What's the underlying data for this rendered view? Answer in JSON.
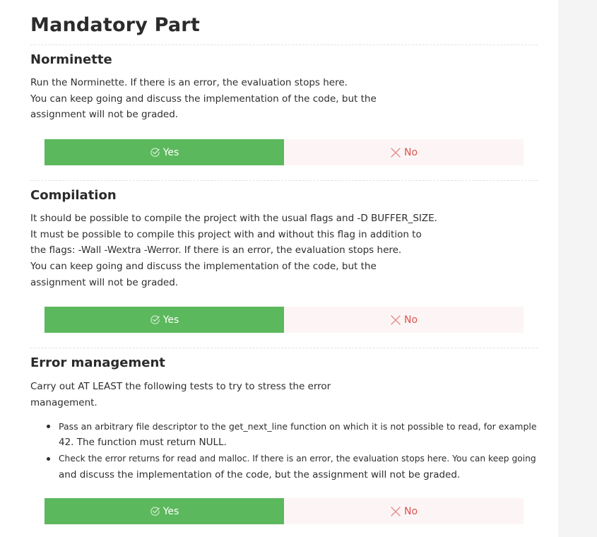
{
  "page": {
    "title": "Mandatory Part"
  },
  "sections": [
    {
      "title": "Norminette",
      "lines": [
        "Run the Norminette. If there is an error, the evaluation stops here.",
        "You can keep going and discuss the implementation of the code, but the",
        "assignment will not be graded."
      ],
      "yes_label": "Yes",
      "no_label": "No"
    },
    {
      "title": "Compilation",
      "lines": [
        "It should be possible to compile the project with the usual flags and -D BUFFER_SIZE.",
        "It must be possible to compile this project with and without this flag in addition to",
        "the flags: -Wall -Wextra -Werror. If there is an error, the evaluation stops here.",
        "You can keep going and discuss the implementation of the code, but the",
        "assignment will not be graded."
      ],
      "yes_label": "Yes",
      "no_label": "No"
    },
    {
      "title": "Error management",
      "lines": [
        "Carry out AT LEAST the following tests to try to stress the error",
        "management."
      ],
      "bullets": [
        {
          "lines": [
            "Pass an arbitrary file descriptor to the get_next_line function on which it is not possible to read, for example",
            "42. The function must return NULL."
          ]
        },
        {
          "lines": [
            "Check the error returns for read and malloc. If there is an error, the evaluation stops here. You can keep going",
            "and discuss the implementation of the code, but the assignment will not be graded."
          ]
        }
      ],
      "yes_label": "Yes",
      "no_label": "No"
    }
  ],
  "colors": {
    "yes_bg": "#5cb85c",
    "no_bg": "#fdf5f5",
    "no_text": "#d9534f"
  },
  "icons": {
    "yes": "check-circle-icon",
    "no": "x-icon"
  }
}
